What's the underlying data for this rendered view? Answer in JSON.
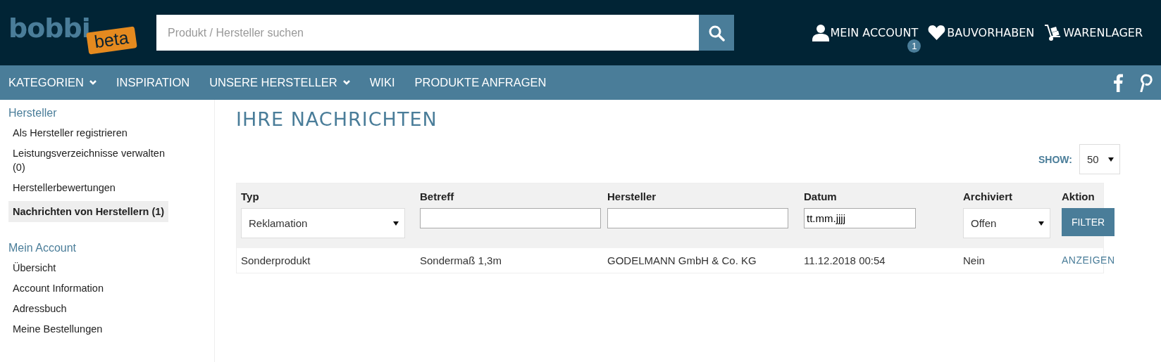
{
  "header": {
    "logo": "bobbi",
    "logo_badge": "beta",
    "search": {
      "placeholder": "Produkt / Hersteller suchen"
    },
    "links": [
      {
        "kind": "account",
        "label": "MEIN ACCOUNT",
        "badge": "1"
      },
      {
        "kind": "heart",
        "label": "BAUVORHABEN"
      },
      {
        "kind": "cart",
        "label": "WARENLAGER"
      }
    ]
  },
  "nav": {
    "items": [
      {
        "label": "KATEGORIEN",
        "dropdown": true
      },
      {
        "label": "INSPIRATION",
        "dropdown": false
      },
      {
        "label": "UNSERE HERSTELLER",
        "dropdown": true
      },
      {
        "label": "WIKI",
        "dropdown": false
      },
      {
        "label": "PRODUKTE ANFRAGEN",
        "dropdown": false
      }
    ],
    "social": [
      {
        "kind": "facebook"
      },
      {
        "kind": "pinterest"
      }
    ]
  },
  "sidebar": {
    "sections": [
      {
        "title": "Hersteller",
        "items": [
          {
            "label": "Als Hersteller registrieren",
            "selected": false
          },
          {
            "label": "Leistungsverzeichnisse verwalten (0)",
            "selected": false
          },
          {
            "label": "Herstellerbewertungen",
            "selected": false
          },
          {
            "label": "Nachrichten von Herstellern (1)",
            "selected": true
          }
        ]
      },
      {
        "title": "Mein Account",
        "items": [
          {
            "label": "Übersicht",
            "selected": false
          },
          {
            "label": "Account Information",
            "selected": false
          },
          {
            "label": "Adressbuch",
            "selected": false
          },
          {
            "label": "Meine Bestellungen",
            "selected": false
          }
        ]
      }
    ]
  },
  "main": {
    "title": "IHRE NACHRICHTEN",
    "show": {
      "label": "SHOW:",
      "value": "50"
    },
    "table": {
      "columns": [
        "Typ",
        "Betreff",
        "Hersteller",
        "Datum",
        "Archiviert",
        "Aktion"
      ],
      "filters": [
        {
          "kind": "select",
          "value": "Reklamation"
        },
        {
          "kind": "text"
        },
        {
          "kind": "text"
        },
        {
          "kind": "text",
          "value": "tt.mm.jjjj"
        },
        {
          "kind": "select",
          "value": "Offen"
        },
        {
          "kind": "button",
          "value": "FILTER"
        }
      ],
      "rows": [
        {
          "cells": [
            "Sonderprodukt",
            "Sondermaß 1,3m",
            "GODELMANN GmbH & Co. KG",
            "11.12.2018 00:54",
            "Nein"
          ],
          "action": "ANZEIGEN"
        }
      ]
    }
  }
}
